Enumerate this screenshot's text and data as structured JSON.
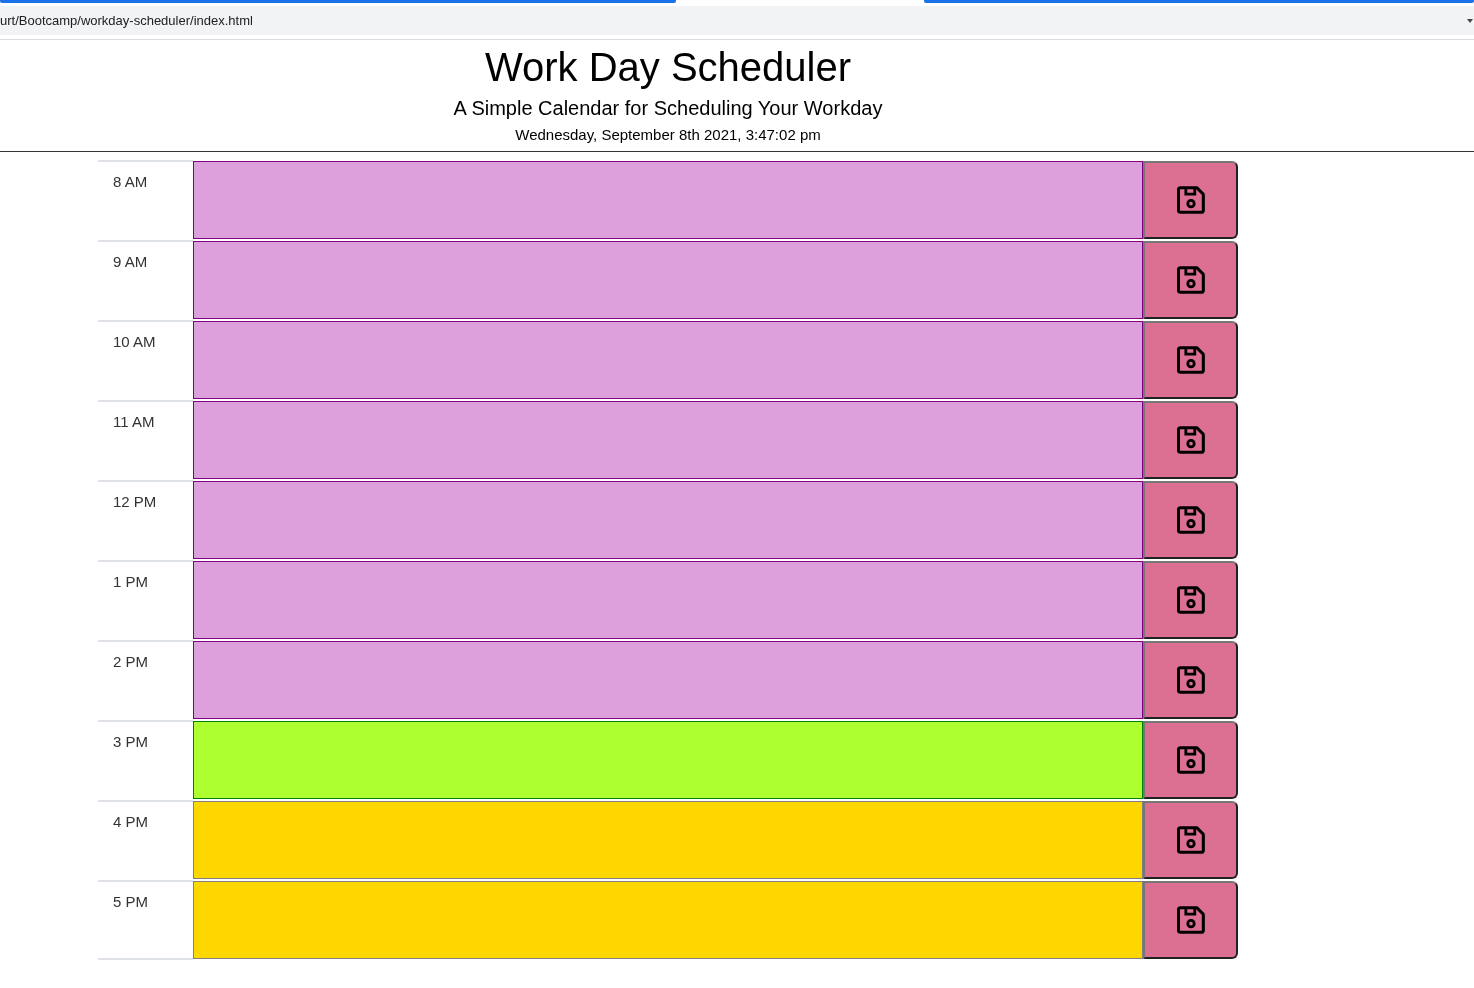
{
  "browser": {
    "address": "urt/Bootcamp/workday-scheduler/index.html"
  },
  "header": {
    "title": "Work Day Scheduler",
    "subtitle": "A Simple Calendar for Scheduling Your Workday",
    "date": "Wednesday, September 8th 2021, 3:47:02 pm"
  },
  "rows": [
    {
      "hour": "8 AM",
      "kind": "past"
    },
    {
      "hour": "9 AM",
      "kind": "past"
    },
    {
      "hour": "10 AM",
      "kind": "past"
    },
    {
      "hour": "11 AM",
      "kind": "past"
    },
    {
      "hour": "12 PM",
      "kind": "past"
    },
    {
      "hour": "1 PM",
      "kind": "past"
    },
    {
      "hour": "2 PM",
      "kind": "past"
    },
    {
      "hour": "3 PM",
      "kind": "present"
    },
    {
      "hour": "4 PM",
      "kind": "future"
    },
    {
      "hour": "5 PM",
      "kind": "future"
    }
  ]
}
